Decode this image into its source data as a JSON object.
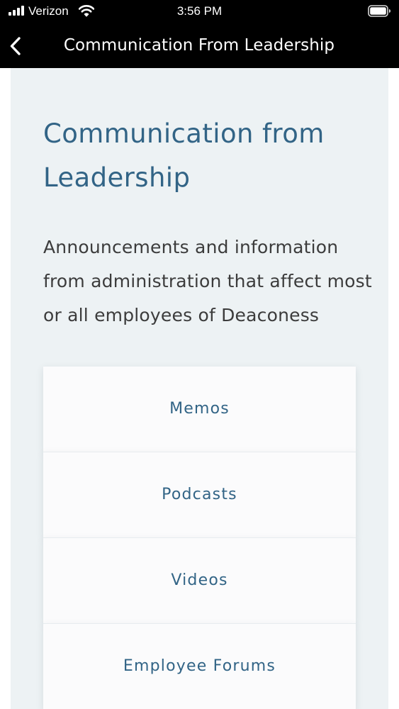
{
  "status_bar": {
    "carrier": "Verizon",
    "time": "3:56 PM",
    "icons": [
      "signal-icon",
      "wifi-icon",
      "battery-icon"
    ]
  },
  "nav": {
    "back_icon": "chevron-left-icon",
    "title": "Communication From Leadership"
  },
  "page": {
    "heading": "Communication from Leadership",
    "description": "Announcements and information from administration that affect most or all employees of Deaconess"
  },
  "menu": {
    "items": [
      {
        "label": "Memos"
      },
      {
        "label": "Podcasts"
      },
      {
        "label": "Videos"
      },
      {
        "label": "Employee Forums"
      }
    ]
  },
  "colors": {
    "status_bar_bg": "#000000",
    "nav_bg": "#000000",
    "content_bg": "#edf2f4",
    "heading": "#326486",
    "body_text": "#3c3c3c",
    "card_bg": "#fbfbfc"
  }
}
